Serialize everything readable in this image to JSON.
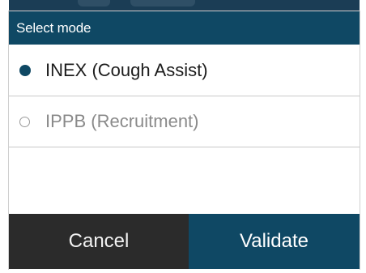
{
  "dialog": {
    "title": "Select mode",
    "options": [
      {
        "label": "INEX (Cough Assist)",
        "selected": true
      },
      {
        "label": "IPPB (Recruitment)",
        "selected": false
      }
    ],
    "buttons": {
      "cancel_label": "Cancel",
      "validate_label": "Validate"
    }
  },
  "colors": {
    "header": "#0f4864",
    "accent": "#0f4864",
    "cancel_bg": "#2b2b2b",
    "selected_text": "#1c1c1c",
    "unselected_text": "#8a8a8a"
  }
}
